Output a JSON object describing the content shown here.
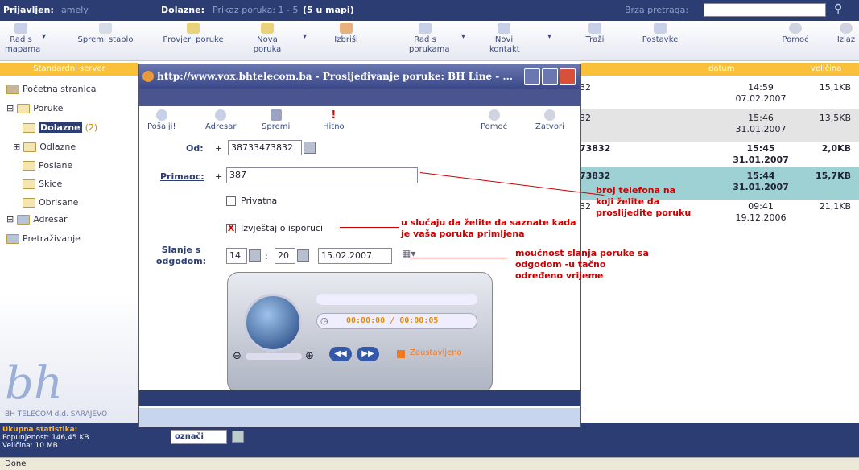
{
  "header": {
    "logged_label": "Prijavljen:",
    "user": "amely",
    "folder_label": "Dolazne:",
    "folder_info": "Prikaz poruka: 1 - 5",
    "folder_count": "(5 u mapi)",
    "search_label": "Brza pretraga:"
  },
  "toolbar": [
    {
      "label": "Rad s mapama"
    },
    {
      "label": "Spremi stablo"
    },
    {
      "label": "Provjeri poruke"
    },
    {
      "label": "Nova poruka"
    },
    {
      "label": "Izbriši"
    },
    {
      "label": "Rad s porukama"
    },
    {
      "label": "Novi kontakt"
    },
    {
      "label": "Traži"
    },
    {
      "label": "Postavke"
    },
    {
      "label": "Pomoć"
    },
    {
      "label": "Izlaz"
    }
  ],
  "server_header": "Standardni server",
  "col_headers": {
    "date": "datum",
    "size": "veličina"
  },
  "tree": {
    "home": "Početna stranica",
    "messages": "Poruke",
    "inbox": "Dolazne",
    "inbox_count": "(2)",
    "outbox": "Odlazne",
    "sent": "Poslane",
    "drafts": "Skice",
    "deleted": "Obrisane",
    "addressbook": "Adresar",
    "search": "Pretraživanje"
  },
  "logo": {
    "text": "bh",
    "sub": "BH TELECOM d.d. SARAJEVO"
  },
  "stats": {
    "title": "Ukupna statistika:",
    "fill": "Popunjenost: 146,45 KB",
    "size": "Veličina: 10 MB"
  },
  "mark_label": "označi",
  "status": "Done",
  "rows": [
    {
      "partial": "32",
      "time": "14:59",
      "date": "07.02.2007",
      "size": "15,1KB",
      "bold": false
    },
    {
      "partial": "32",
      "time": "15:46",
      "date": "31.01.2007",
      "size": "13,5KB",
      "bold": false
    },
    {
      "partial": "73832",
      "time": "15:45",
      "date": "31.01.2007",
      "size": "2,0KB",
      "bold": true
    },
    {
      "partial": "73832",
      "time": "15:44",
      "date": "31.01.2007",
      "size": "15,7KB",
      "bold": true
    },
    {
      "partial": "32",
      "time": "09:41",
      "date": "19.12.2006",
      "size": "21,1KB",
      "bold": false
    }
  ],
  "popup": {
    "title": "http://www.vox.bhtelecom.ba - Prosljeđivanje poruke: BH Line - ...",
    "toolbar": {
      "send": "Pošalji!",
      "addressbook": "Adresar",
      "save": "Spremi",
      "urgent": "Hitno",
      "help": "Pomoć",
      "close": "Zatvori"
    },
    "from_label": "Od:",
    "from_plus": "+",
    "from_value": "38733473832",
    "to_label": "Primaoc:",
    "to_plus": "+",
    "to_value": "387",
    "private_label": "Privatna",
    "report_label": "Izvještaj o isporuci",
    "delay_label": "Slanje s odgodom:",
    "hour": "14",
    "minute": "20",
    "date": "15.02.2007",
    "colon": ":",
    "timer": "00:00:00 / 00:00:05",
    "player_status": "Zaustavljeno"
  },
  "annotations": {
    "phone": "broj telefona na koji želite da proslijedite poruku",
    "report": "u slučaju da želite da saznate kada je vaša poruka primljena",
    "delay": "moućnost slanja poruke sa odgodom -u tačno određeno vrijeme"
  }
}
